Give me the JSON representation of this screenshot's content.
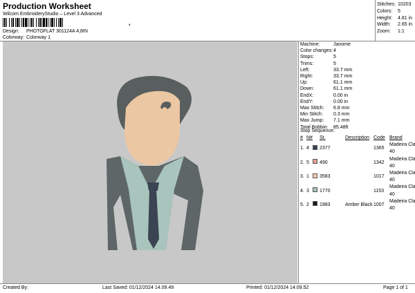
{
  "header": {
    "title": "Production Worksheet",
    "subtitle": "Wilcom EmbroideryStudio – Level 3 Advanced",
    "barcode_suffix": ","
  },
  "meta": {
    "design_label": "Design:",
    "design_value": "PHOTOFLAT 301124A 4,8IN",
    "colorway_label": "Colorway:",
    "colorway_value": "Colorway 1"
  },
  "stats": [
    {
      "k": "Stitches:",
      "v": "10203"
    },
    {
      "k": "Colors:",
      "v": "5"
    },
    {
      "k": "Height:",
      "v": "4.81 in"
    },
    {
      "k": "Width:",
      "v": "2.65 in"
    },
    {
      "k": "Zoom:",
      "v": "1:1"
    }
  ],
  "details": [
    {
      "k": "Machine:",
      "v": "Janome"
    },
    {
      "k": "Color changes:",
      "v": "4"
    },
    {
      "k": "Stops:",
      "v": "5"
    },
    {
      "k": "Trims:",
      "v": "5"
    },
    {
      "k": "Left:",
      "v": "33.7 mm"
    },
    {
      "k": "Right:",
      "v": "33.7 mm"
    },
    {
      "k": "Up:",
      "v": "61.1 mm"
    },
    {
      "k": "Down:",
      "v": "61.1 mm"
    },
    {
      "k": "EndX:",
      "v": "0.00 in"
    },
    {
      "k": "EndY:",
      "v": "0.00 in"
    },
    {
      "k": "Max Stitch:",
      "v": "6.8 mm"
    },
    {
      "k": "Min Stitch:",
      "v": "0.3 mm"
    },
    {
      "k": "Max Jump:",
      "v": "7.1 mm"
    },
    {
      "k": "Total Bobbin:",
      "v": "85.48ft"
    }
  ],
  "stop_sequence": {
    "title": "Stop Sequence:",
    "headers": [
      "#",
      "N#",
      "",
      "St.",
      "Description",
      "Code",
      "Brand"
    ],
    "rows": [
      {
        "n": "1.",
        "nn": "4",
        "color": "#3a4452",
        "st": "2377",
        "desc": "",
        "code": "1365",
        "brand": "Madeira Classic 40"
      },
      {
        "n": "2.",
        "nn": "5",
        "color": "#e0a08a",
        "st": "490",
        "desc": "",
        "code": "1342",
        "brand": "Madeira Classic 40"
      },
      {
        "n": "3.",
        "nn": "1",
        "color": "#f3c9b0",
        "st": "3583",
        "desc": "",
        "code": "1017",
        "brand": "Madeira Classic 40"
      },
      {
        "n": "4.",
        "nn": "3",
        "color": "#a9c4bc",
        "st": "1770",
        "desc": "",
        "code": "1153",
        "brand": "Madeira Classic 40"
      },
      {
        "n": "5.",
        "nn": "2",
        "color": "#1a1a1a",
        "st": "1983",
        "desc": "Amber Black",
        "code": "1007",
        "brand": "Madeira Classic 40"
      }
    ]
  },
  "footer": {
    "created_by": "Created By:",
    "last_saved": "Last Saved: 01/12/2024 14.09.49",
    "printed": "Printed: 01/12/2024 14.09.52",
    "page": "Page 1 of 1"
  }
}
